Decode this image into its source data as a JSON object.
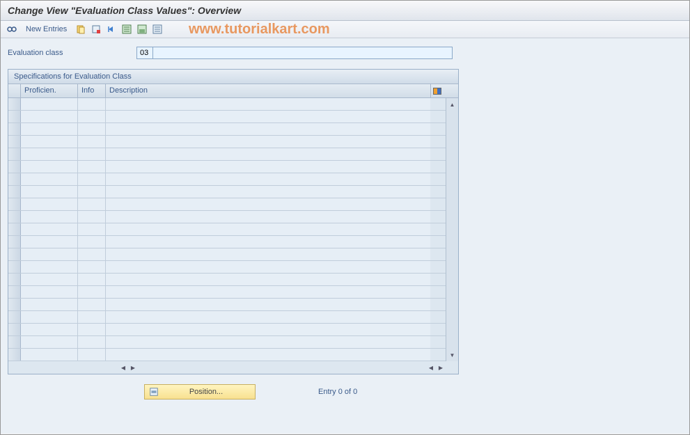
{
  "title": "Change View \"Evaluation Class Values\": Overview",
  "toolbar": {
    "new_entries_label": "New Entries"
  },
  "watermark": "www.tutorialkart.com",
  "form": {
    "eval_class_label": "Evaluation class",
    "eval_class_value": "03",
    "eval_class_desc": ""
  },
  "panel": {
    "header": "Specifications for Evaluation Class",
    "columns": {
      "col1": "Proficien.",
      "col2": "Info",
      "col3": "Description"
    },
    "row_count": 21
  },
  "footer": {
    "position_label": "Position...",
    "entry_text": "Entry 0 of 0"
  }
}
